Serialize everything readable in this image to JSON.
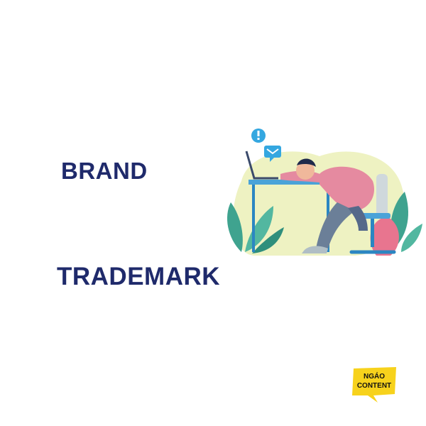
{
  "headings": {
    "brand": "BRAND",
    "trademark": "TRADEMARK"
  },
  "logo": {
    "line1": "NGÁO",
    "line2": "CONTENT",
    "color": "#f7d21c"
  },
  "colors": {
    "heading": "#1f2a6b",
    "blob": "#eef2c2",
    "leaf": "#3fa38f",
    "shirt": "#e58aa0",
    "desk": "#4aa3d8",
    "icon_alert": "#34a7e0"
  },
  "icons": [
    "alert-icon",
    "mail-icon"
  ]
}
